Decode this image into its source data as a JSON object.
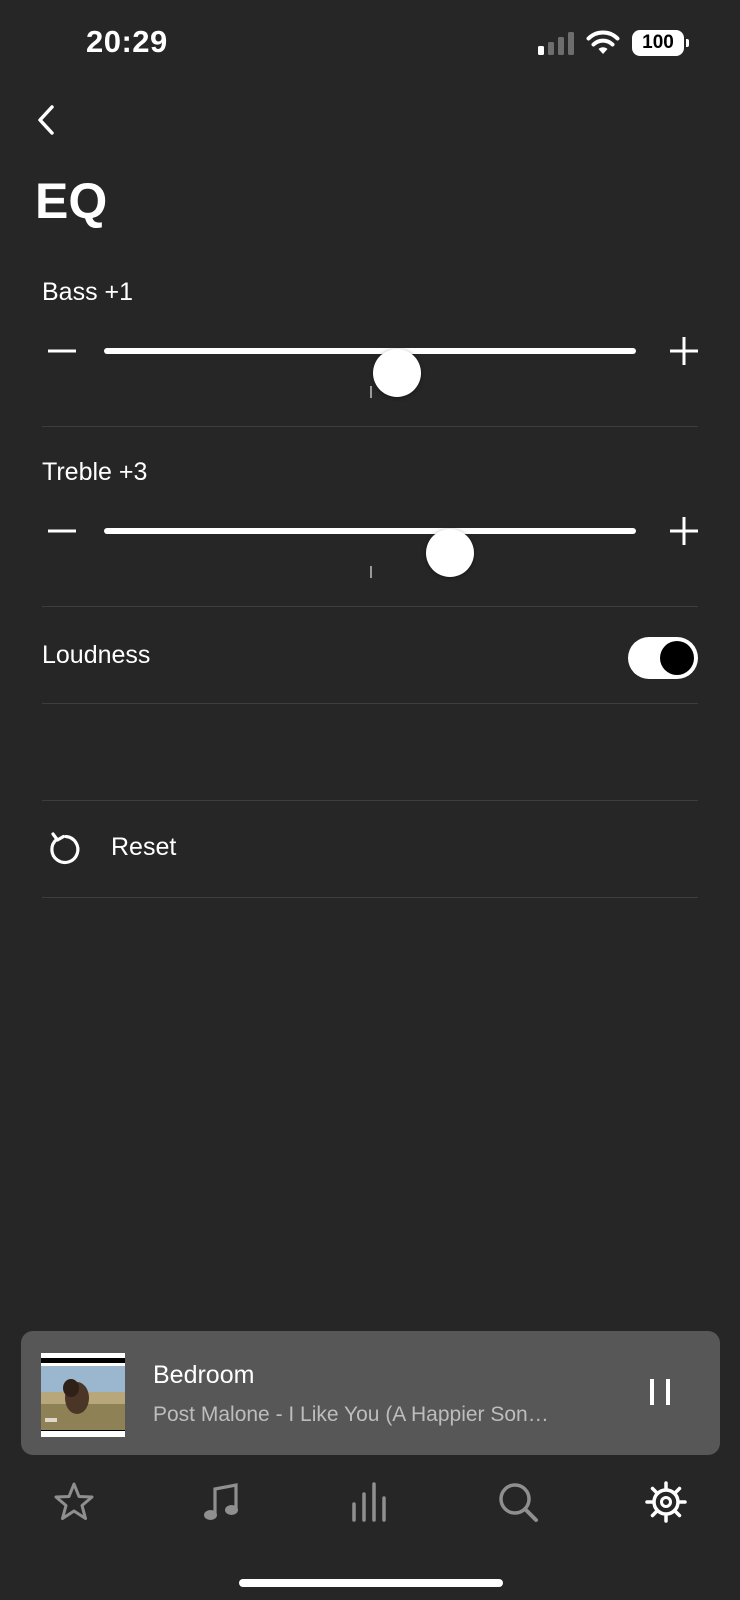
{
  "status_bar": {
    "time": "20:29",
    "battery": "100"
  },
  "header": {
    "title": "EQ"
  },
  "bass": {
    "label": "Bass +1",
    "value": 1,
    "min": -10,
    "max": 10
  },
  "treble": {
    "label": "Treble +3",
    "value": 3,
    "min": -10,
    "max": 10
  },
  "loudness": {
    "label": "Loudness",
    "enabled": true
  },
  "reset": {
    "label": "Reset"
  },
  "now_playing": {
    "room": "Bedroom",
    "track": "Post Malone - I Like You (A Happier Son…"
  },
  "tabs": [
    "favorites-icon",
    "music-icon",
    "rooms-icon",
    "search-icon",
    "settings-icon"
  ],
  "colors": {
    "background": "#262626",
    "player": "#575757",
    "accent": "#ffffff"
  }
}
